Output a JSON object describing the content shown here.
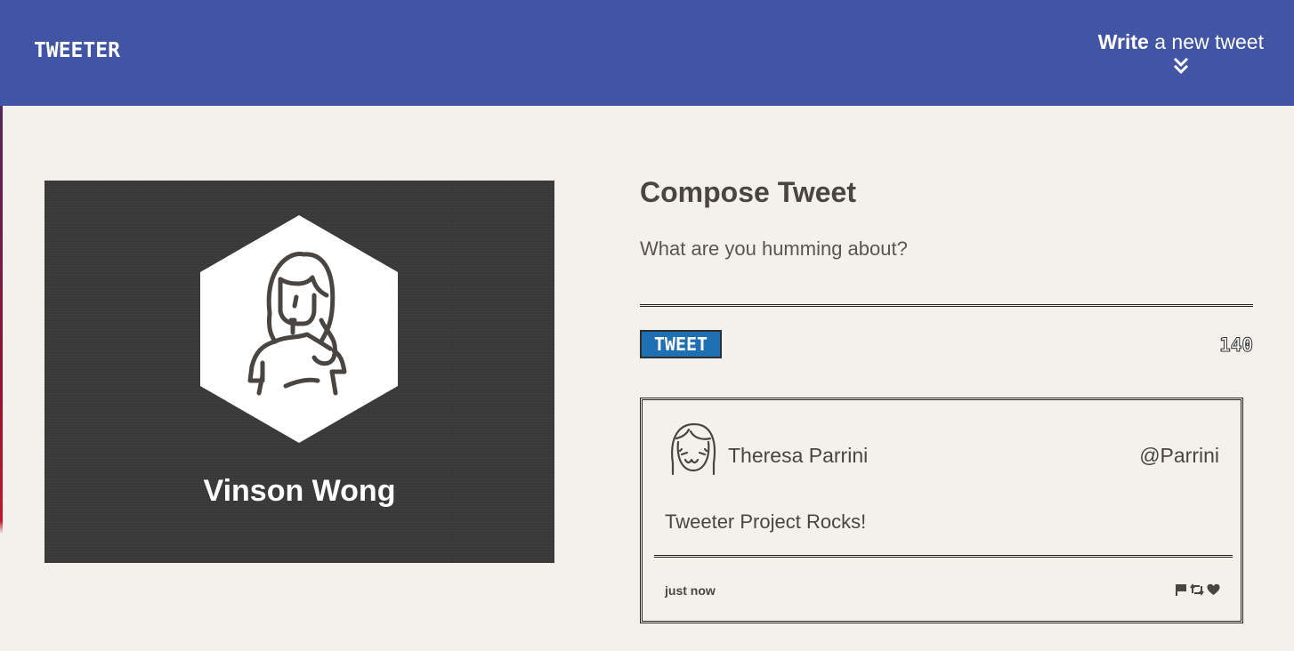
{
  "header": {
    "logo": "TWEETER",
    "write_bold": "Write",
    "write_rest": " a new tweet",
    "toggle_icon": "double-chevron-down-icon",
    "background_color": "#4255a4"
  },
  "profile": {
    "name": "Vinson Wong",
    "avatar_icon": "hexagon-avatar-icon",
    "card_color": "#3a3a3a"
  },
  "compose": {
    "title": "Compose Tweet",
    "placeholder": "What are you humming about?",
    "button_label": "TWEET",
    "button_color": "#1f6fb3",
    "counter": "140"
  },
  "tweets": [
    {
      "author": "Theresa Parrini",
      "handle": "@Parrini",
      "body": "Tweeter Project Rocks!",
      "time": "just now",
      "actions": [
        "flag-icon",
        "retweet-icon",
        "heart-icon"
      ]
    }
  ],
  "colors": {
    "page_background": "#f4f1ec",
    "text": "#4a4540"
  }
}
